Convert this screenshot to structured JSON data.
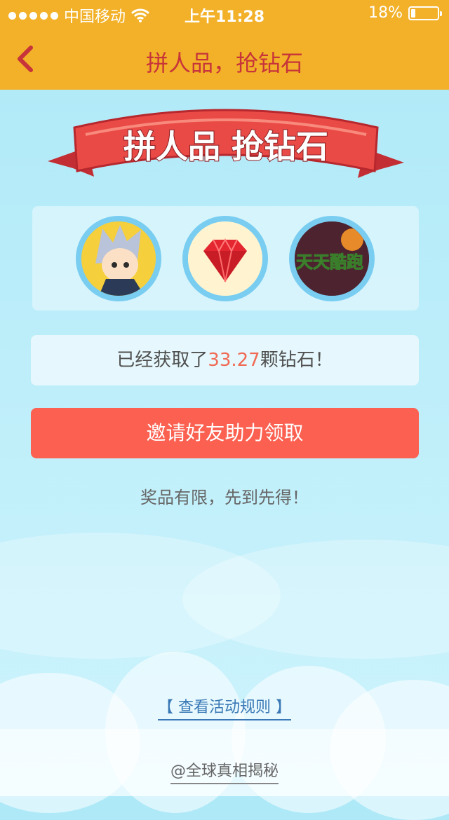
{
  "status_bar": {
    "carrier": "中国移动",
    "time": "上午11:28",
    "battery_percent": "18%",
    "battery_level": 0.18,
    "signal_icon": "signal-dots-icon",
    "wifi_icon": "wifi-icon"
  },
  "nav": {
    "title": "拼人品，抢钻石",
    "back_icon": "chevron-left-icon"
  },
  "banner": {
    "text": "拼人品 抢钻石"
  },
  "games": [
    {
      "name": "hero-avatar",
      "icon": "anime-character-icon"
    },
    {
      "name": "diamond",
      "icon": "red-diamond-icon"
    },
    {
      "name": "tiantian-kupao",
      "icon": "tiantian-kupao-logo",
      "logo_text": "天天酷跑"
    }
  ],
  "diamond_status": {
    "prefix": "已经获取了",
    "amount": "33.27",
    "suffix": "颗钻石！"
  },
  "invite_button": {
    "label": "邀请好友助力领取"
  },
  "limited_notice": "奖品有限，先到先得！",
  "rules_link": "【 查看活动规则 】",
  "source_link": "@全球真相揭秘",
  "colors": {
    "header": "#f2b128",
    "title": "#c7343a",
    "button": "#fb6050",
    "highlight": "#f06a55",
    "link": "#3978b5"
  }
}
